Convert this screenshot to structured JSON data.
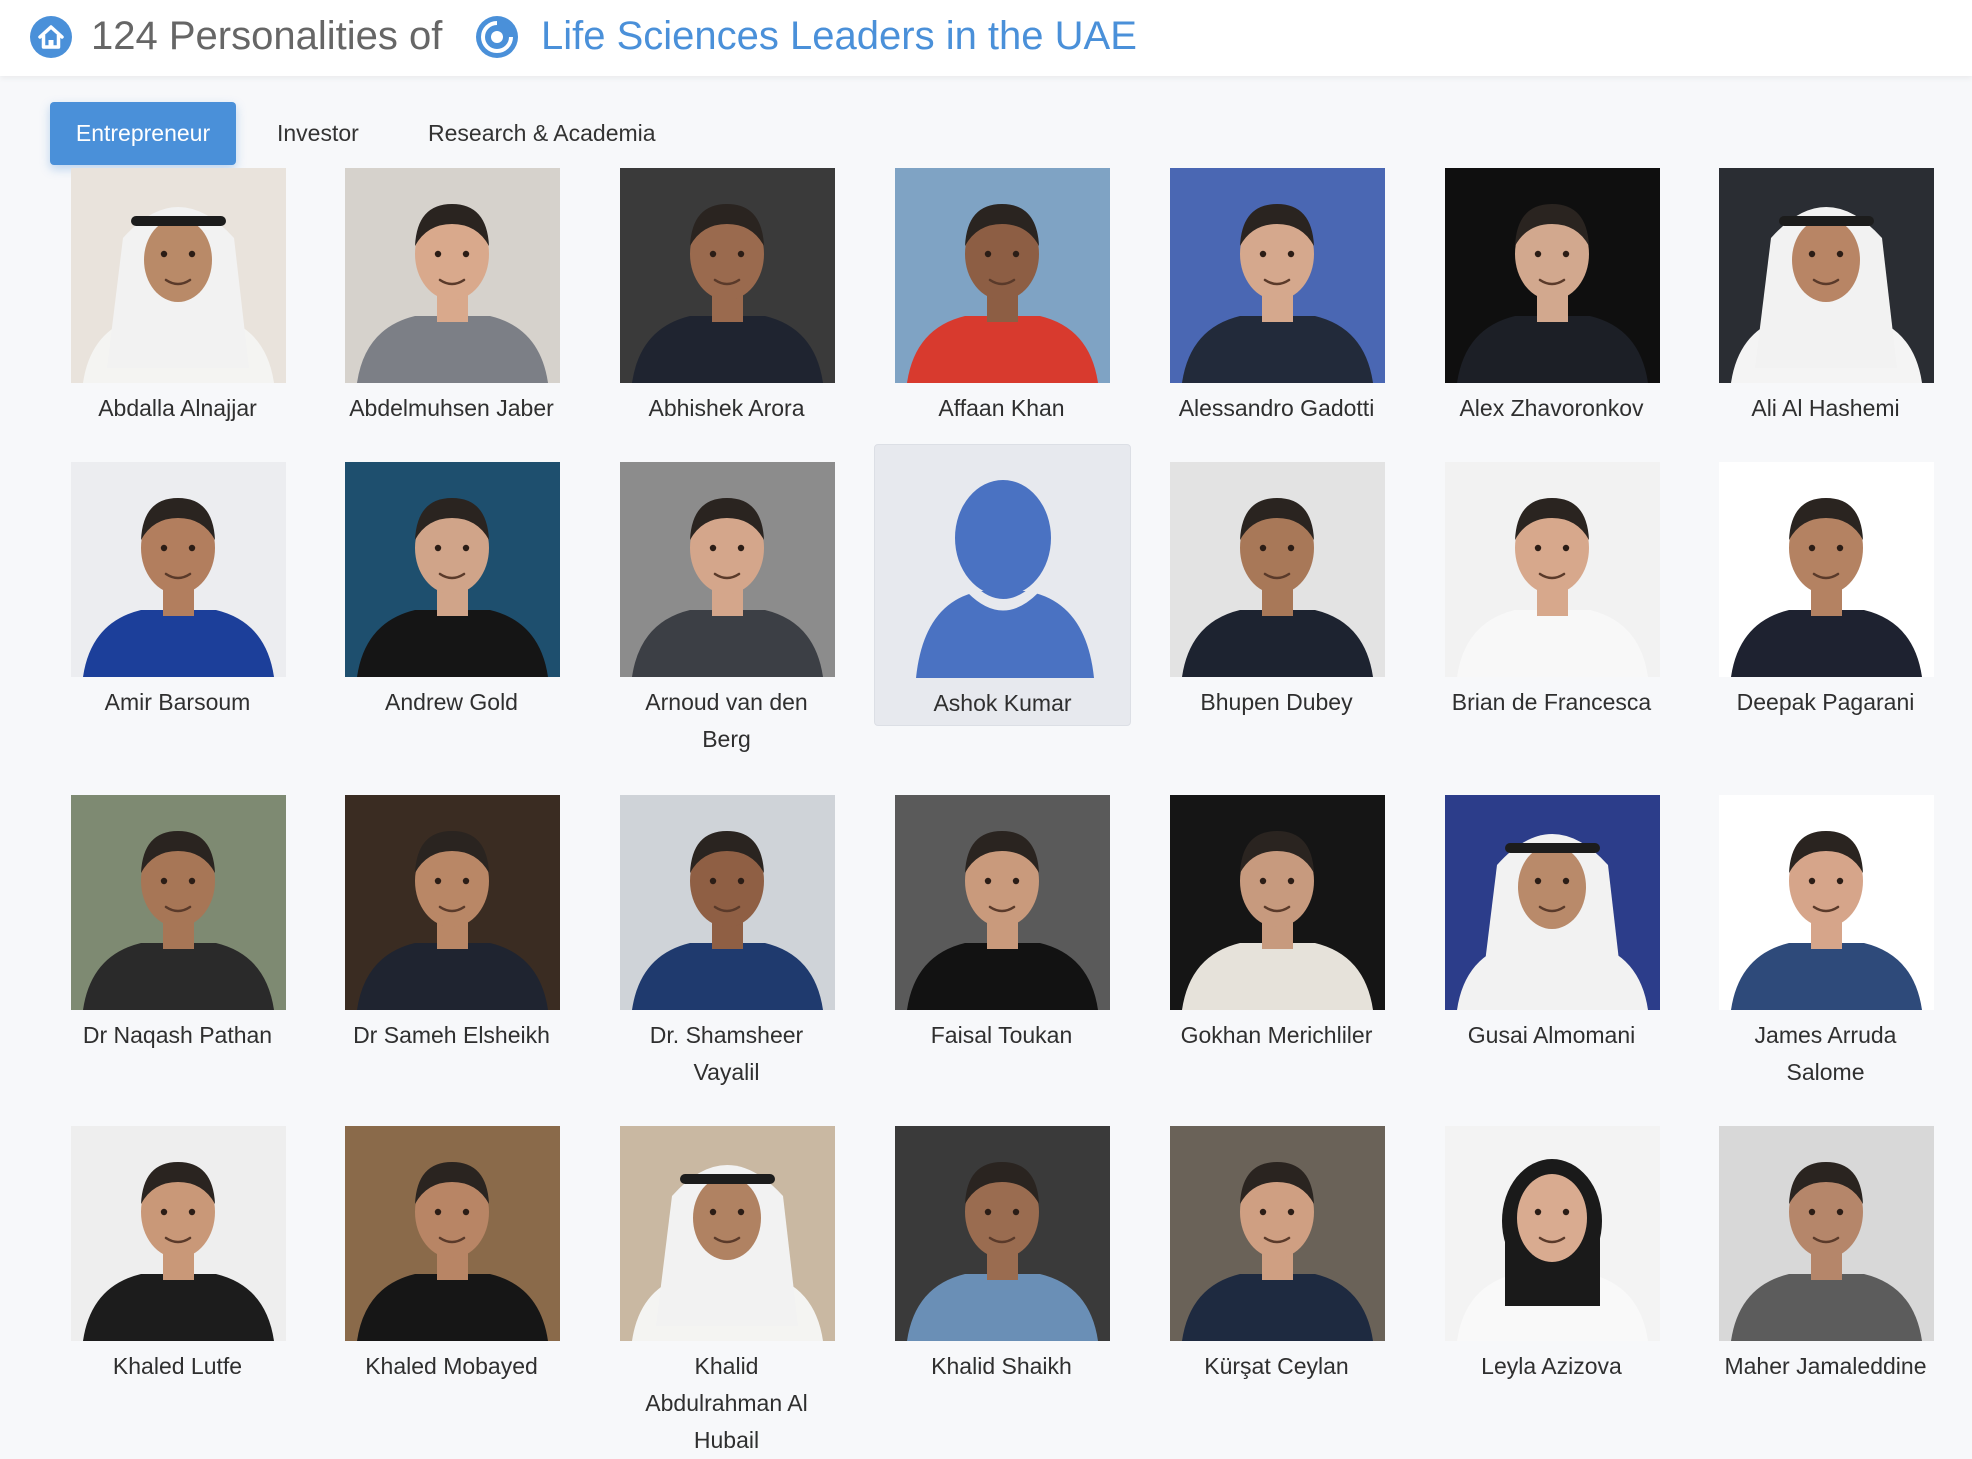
{
  "header": {
    "count_text": "124 Personalities of",
    "community_link": "Life Sciences Leaders in the UAE"
  },
  "tabs": [
    {
      "label": "Entrepreneur",
      "active": true
    },
    {
      "label": "Investor",
      "active": false
    },
    {
      "label": "Research & Academia",
      "active": false
    }
  ],
  "people": [
    {
      "name": "Abdalla Alnajjar",
      "bg": "#e9e3dc",
      "skin": "#b98a68",
      "shirt": "#f4f4f2",
      "headwear": "ghutra"
    },
    {
      "name": "Abdelmuhsen Jaber",
      "bg": "#d6d2cc",
      "skin": "#d9a98c",
      "shirt": "#7c7f86",
      "headwear": "none"
    },
    {
      "name": "Abhishek Arora",
      "bg": "#3a3a3a",
      "skin": "#9a6a4e",
      "shirt": "#1f2430",
      "headwear": "none"
    },
    {
      "name": "Affaan Khan",
      "bg": "#7fa3c4",
      "skin": "#8d5e44",
      "shirt": "#d83a2e",
      "headwear": "none"
    },
    {
      "name": "Alessandro Gadotti",
      "bg": "#4a67b3",
      "skin": "#d5a88d",
      "shirt": "#222a3a",
      "headwear": "none"
    },
    {
      "name": "Alex Zhavoronkov",
      "bg": "#0f0f0f",
      "skin": "#d2a88e",
      "shirt": "#1c1f26",
      "headwear": "none"
    },
    {
      "name": "Ali Al Hashemi",
      "bg": "#2a2d33",
      "skin": "#b88565",
      "shirt": "#f4f4f4",
      "headwear": "ghutra"
    },
    {
      "name": "Amir Barsoum",
      "bg": "#ecedf0",
      "skin": "#b27e5e",
      "shirt": "#1c3f9a",
      "headwear": "none"
    },
    {
      "name": "Andrew Gold",
      "bg": "#1e4f6e",
      "skin": "#d0a489",
      "shirt": "#151515",
      "headwear": "none"
    },
    {
      "name": "Arnoud van den Berg",
      "bg": "#8c8c8c",
      "skin": "#d4a68b",
      "shirt": "#3c3f45",
      "headwear": "none"
    },
    {
      "name": "Ashok Kumar",
      "bg": "placeholder",
      "skin": "",
      "shirt": "",
      "headwear": "none"
    },
    {
      "name": "Bhupen Dubey",
      "bg": "#e3e3e3",
      "skin": "#a87858",
      "shirt": "#1d2330",
      "headwear": "none"
    },
    {
      "name": "Brian de Francesca",
      "bg": "#f2f2f2",
      "skin": "#d7a88c",
      "shirt": "#f8f8f8",
      "headwear": "none"
    },
    {
      "name": "Deepak Pagarani",
      "bg": "#ffffff",
      "skin": "#b48262",
      "shirt": "#1e2230",
      "headwear": "none"
    },
    {
      "name": "Dr Naqash Pathan",
      "bg": "#7e8a72",
      "skin": "#a77656",
      "shirt": "#2a2a2a",
      "headwear": "none"
    },
    {
      "name": "Dr Sameh Elsheikh",
      "bg": "#3a2c22",
      "skin": "#b98766",
      "shirt": "#1f2430",
      "headwear": "none"
    },
    {
      "name": "Dr. Shamsheer Vayalil",
      "bg": "#cfd3d8",
      "skin": "#8f5f44",
      "shirt": "#1f3a6e",
      "headwear": "none"
    },
    {
      "name": "Faisal Toukan",
      "bg": "#5a5a5a",
      "skin": "#c99a7c",
      "shirt": "#121212",
      "headwear": "none"
    },
    {
      "name": "Gokhan Merichliler",
      "bg": "#151515",
      "skin": "#c79a7e",
      "shirt": "#e6e2da",
      "headwear": "none"
    },
    {
      "name": "Gusai Almomani",
      "bg": "#2c3d8a",
      "skin": "#b98a6a",
      "shirt": "#f2f2f2",
      "headwear": "ghutra"
    },
    {
      "name": "James Arruda Salome",
      "bg": "#ffffff",
      "skin": "#d6a58a",
      "shirt": "#2e4a7a",
      "headwear": "none"
    },
    {
      "name": "Khaled Lutfe",
      "bg": "#eeeeee",
      "skin": "#c99878",
      "shirt": "#1c1c1c",
      "headwear": "none"
    },
    {
      "name": "Khaled Mobayed",
      "bg": "#8a6a4a",
      "skin": "#b88565",
      "shirt": "#161616",
      "headwear": "none"
    },
    {
      "name": "Khalid Abdulrahman Al Hubail",
      "bg": "#c9b8a2",
      "skin": "#b08262",
      "shirt": "#f4f4f2",
      "headwear": "ghutra"
    },
    {
      "name": "Khalid Shaikh",
      "bg": "#3a3a3a",
      "skin": "#9a6c50",
      "shirt": "#6a8fb6",
      "headwear": "none"
    },
    {
      "name": "Kürşat Ceylan",
      "bg": "#6a6258",
      "skin": "#cf9f82",
      "shirt": "#1e2a40",
      "headwear": "none"
    },
    {
      "name": "Leyla Azizova",
      "bg": "#f3f3f3",
      "skin": "#d9ab90",
      "shirt": "#f9f9f9",
      "headwear": "longhair"
    },
    {
      "name": "Maher Jamaleddine",
      "bg": "#d8d8d8",
      "skin": "#b5866a",
      "shirt": "#5c5c5c",
      "headwear": "none"
    }
  ]
}
